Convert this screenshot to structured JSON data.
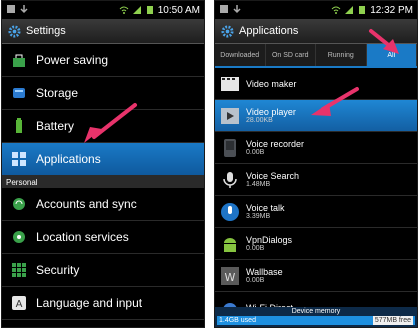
{
  "left": {
    "status": {
      "time": "10:50 AM"
    },
    "title": "Settings",
    "rows_top": [
      {
        "label": "Power saving",
        "icon": "power-saving-icon",
        "color": "#3aa14a"
      },
      {
        "label": "Storage",
        "icon": "storage-icon",
        "color": "#2b7bd1"
      },
      {
        "label": "Battery",
        "icon": "battery-icon",
        "color": "#58b538"
      },
      {
        "label": "Applications",
        "icon": "applications-icon",
        "color": "#2f6ccf"
      }
    ],
    "section": "Personal",
    "rows_bottom": [
      {
        "label": "Accounts and sync",
        "icon": "sync-icon",
        "color": "#3aa14a"
      },
      {
        "label": "Location services",
        "icon": "location-icon",
        "color": "#3aa14a"
      },
      {
        "label": "Security",
        "icon": "security-icon",
        "color": "#3aa14a"
      },
      {
        "label": "Language and input",
        "icon": "keyboard-icon",
        "color": "#cfcfcf"
      }
    ]
  },
  "right": {
    "status": {
      "time": "12:32 PM"
    },
    "title": "Applications",
    "tabs": [
      "Downloaded",
      "On SD card",
      "Running",
      "All"
    ],
    "apps": [
      {
        "name": "Video maker",
        "size": "",
        "icon": "video-maker-icon",
        "color": "#4a4a4a"
      },
      {
        "name": "Video player",
        "size": "28.00KB",
        "icon": "video-player-icon",
        "color": "#9aa3ad"
      },
      {
        "name": "Voice recorder",
        "size": "0.00B",
        "icon": "voice-recorder-icon",
        "color": "#4b4f55"
      },
      {
        "name": "Voice Search",
        "size": "1.48MB",
        "icon": "microphone-icon",
        "color": "#d9d9d9"
      },
      {
        "name": "Voice talk",
        "size": "3.39MB",
        "icon": "voice-talk-icon",
        "color": "#1e74c6"
      },
      {
        "name": "VpnDialogs",
        "size": "0.00B",
        "icon": "android-icon",
        "color": "#86c440"
      },
      {
        "name": "Wallbase",
        "size": "0.00B",
        "icon": "wallbase-icon",
        "color": "#5a5a5a"
      },
      {
        "name": "Wi-Fi Direct",
        "size": "",
        "icon": "wifi-direct-icon",
        "color": "#3b7bd1"
      }
    ],
    "memory": {
      "title": "Device memory",
      "used": "1.4GB used",
      "free": "577MB free"
    }
  },
  "colors": {
    "accent": "#1a7ac6",
    "arrow": "#e8336b"
  }
}
